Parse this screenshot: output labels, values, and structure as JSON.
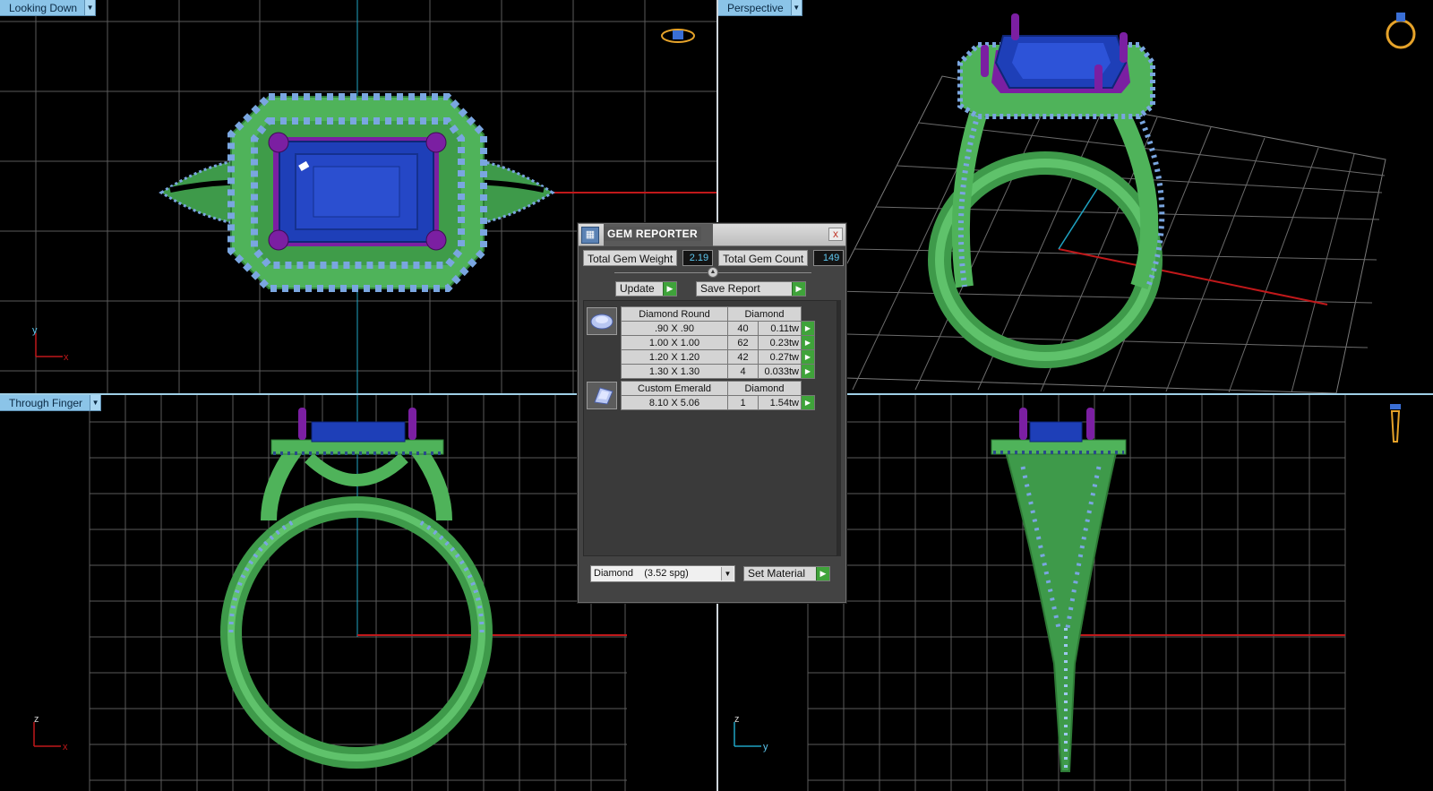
{
  "viewports": {
    "top_left": {
      "label": "Looking Down",
      "axis_v": "y",
      "axis_h": "x"
    },
    "top_right": {
      "label": "Perspective"
    },
    "bottom_left": {
      "label": "Through Finger",
      "axis_v": "z",
      "axis_h": "x"
    },
    "bottom_right": {
      "axis_v": "z",
      "axis_h": "y"
    }
  },
  "gem_reporter": {
    "title": "GEM REPORTER",
    "close_glyph": "x",
    "total_weight_label": "Total Gem Weight",
    "total_weight_value": "2.19",
    "total_count_label": "Total Gem Count",
    "total_count_value": "149",
    "update_label": "Update",
    "save_report_label": "Save Report",
    "groups": [
      {
        "shape": "Diamond Round",
        "material": "Diamond",
        "icon": "round-gem-icon",
        "rows": [
          {
            "size": ".90 X .90",
            "count": "40",
            "weight": "0.11tw"
          },
          {
            "size": "1.00 X 1.00",
            "count": "62",
            "weight": "0.23tw"
          },
          {
            "size": "1.20 X 1.20",
            "count": "42",
            "weight": "0.27tw"
          },
          {
            "size": "1.30 X 1.30",
            "count": "4",
            "weight": "0.033tw"
          }
        ]
      },
      {
        "shape": "Custom Emerald",
        "material": "Diamond",
        "icon": "emerald-gem-icon",
        "rows": [
          {
            "size": "8.10 X 5.06",
            "count": "1",
            "weight": "1.54tw"
          }
        ]
      }
    ],
    "material_select_value": "Diamond    (3.52 spg)",
    "set_material_label": "Set Material"
  },
  "colors": {
    "metal": "#4fb35a",
    "center_stone": "#1e3fb8",
    "prongs": "#7b1fa2",
    "accent_stones": "#7aa6e0",
    "grid": "#6b6b6b",
    "axis_x": "#c0181a",
    "axis_y": "#1fa3c2",
    "label_bg": "#8bc4e8"
  }
}
